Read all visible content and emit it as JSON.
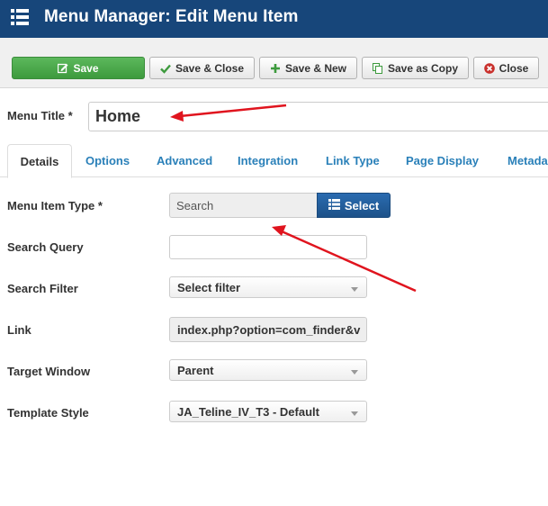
{
  "header": {
    "title": "Menu Manager: Edit Menu Item",
    "icon": "list-menu-icon"
  },
  "toolbar": {
    "save": "Save",
    "save_close": "Save & Close",
    "save_new": "Save & New",
    "save_copy": "Save as Copy",
    "close": "Close"
  },
  "menu_title": {
    "label": "Menu Title *",
    "value": "Home"
  },
  "tabs": [
    {
      "label": "Details",
      "active": true
    },
    {
      "label": "Options"
    },
    {
      "label": "Advanced"
    },
    {
      "label": "Integration"
    },
    {
      "label": "Link Type"
    },
    {
      "label": "Page Display"
    },
    {
      "label": "Metada"
    }
  ],
  "form": {
    "menu_item_type": {
      "label": "Menu Item Type *",
      "value": "Search",
      "button": "Select"
    },
    "search_query": {
      "label": "Search Query",
      "value": ""
    },
    "search_filter": {
      "label": "Search Filter",
      "value": "Select filter"
    },
    "link": {
      "label": "Link",
      "value": "index.php?option=com_finder&v"
    },
    "target_window": {
      "label": "Target Window",
      "value": "Parent"
    },
    "template_style": {
      "label": "Template Style",
      "value": "JA_Teline_IV_T3 - Default"
    }
  },
  "colors": {
    "header": "#17467a",
    "save_green": "#4cae4c",
    "primary_blue": "#2a6bb0",
    "link_blue": "#2a80b9",
    "arrow_red": "#e0141e"
  }
}
